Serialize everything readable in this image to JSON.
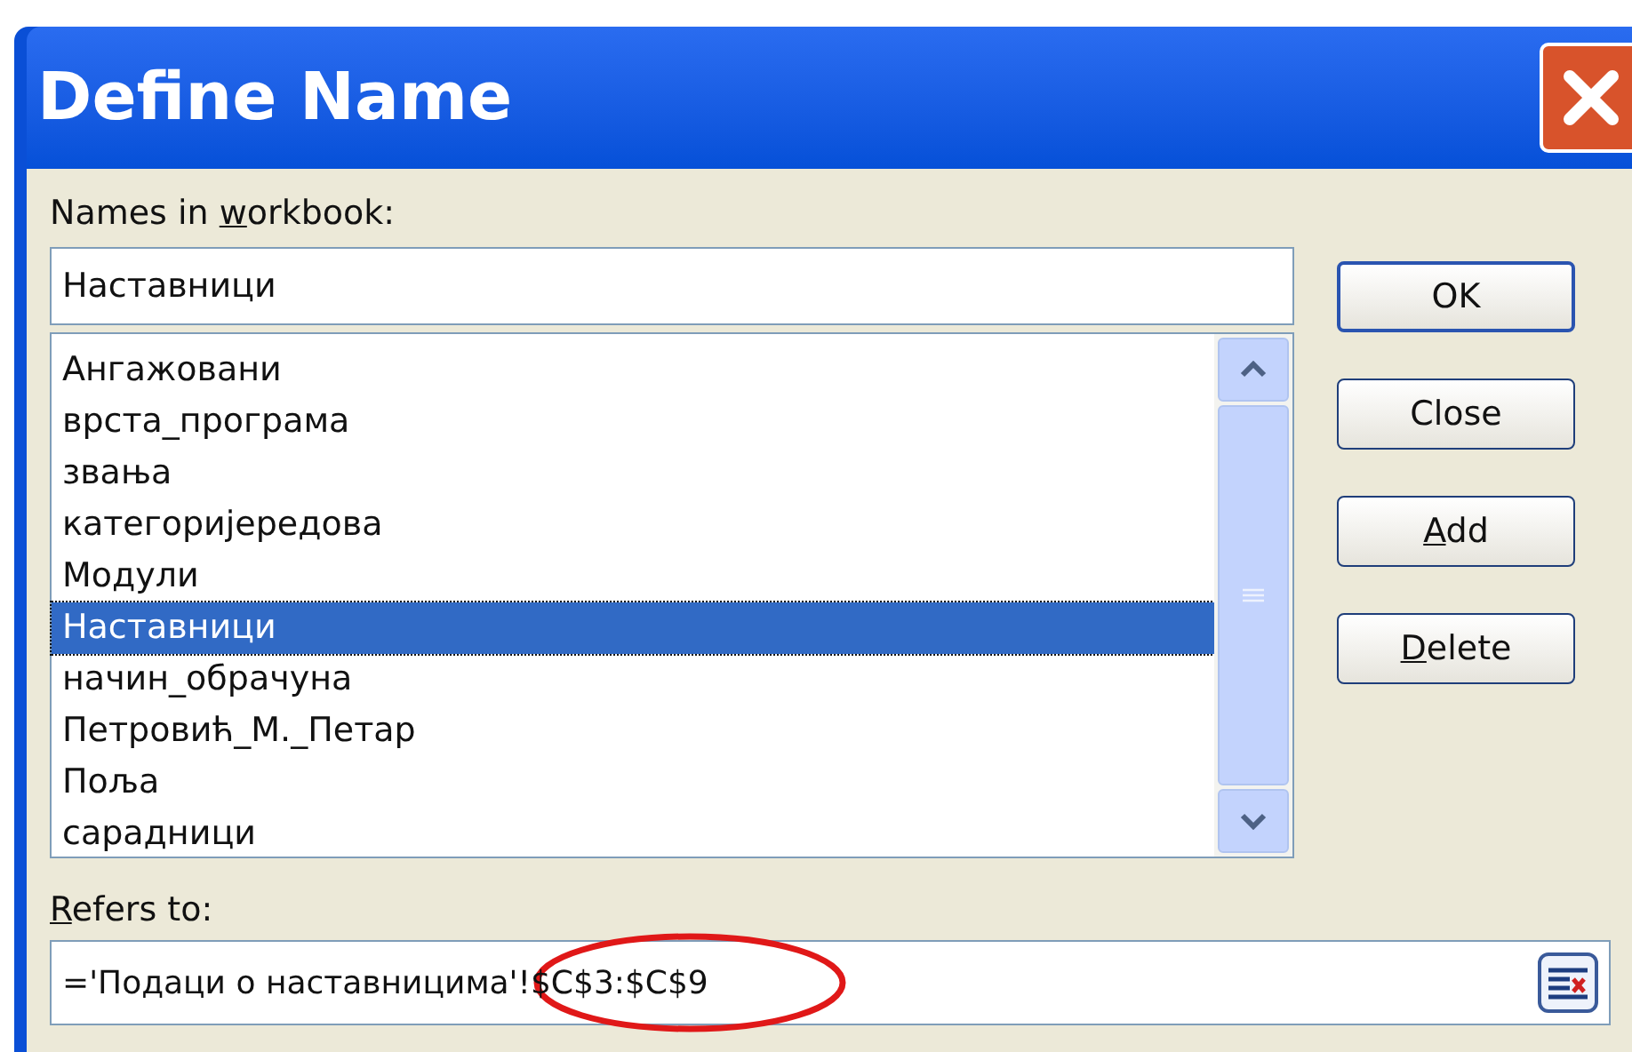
{
  "window": {
    "title": "Define Name"
  },
  "names_label": {
    "before": "Names in ",
    "access_key": "w",
    "after": "orkbook:"
  },
  "name_field": {
    "value": "Наставници"
  },
  "names_list": [
    {
      "label": "Ангажовани",
      "selected": false
    },
    {
      "label": "врста_програма",
      "selected": false
    },
    {
      "label": "звања",
      "selected": false
    },
    {
      "label": "категоријередова",
      "selected": false
    },
    {
      "label": "Модули",
      "selected": false
    },
    {
      "label": "Наставници",
      "selected": true
    },
    {
      "label": "начин_обрачуна",
      "selected": false
    },
    {
      "label": "Петровић_М._Петар",
      "selected": false
    },
    {
      "label": "Поља",
      "selected": false
    },
    {
      "label": "сарадници",
      "selected": false
    }
  ],
  "buttons": [
    {
      "after": "OK",
      "default": true
    },
    {
      "after": "Close",
      "default": false
    },
    {
      "access_key": "A",
      "after": "dd",
      "default": false
    },
    {
      "access_key": "D",
      "after": "elete",
      "default": false
    }
  ],
  "refers_label": {
    "access_key": "R",
    "after": "efers to:"
  },
  "refers_field": {
    "value": "='Подаци о наставницима'!$C$3:$C$9",
    "circled": true
  }
}
